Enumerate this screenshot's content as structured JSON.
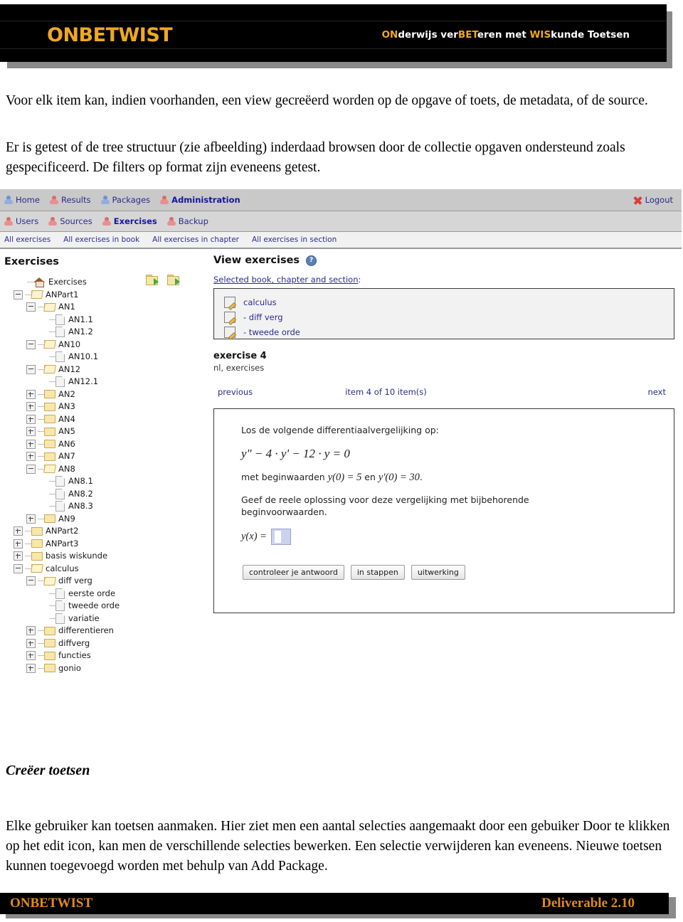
{
  "banner": {
    "logo": "ONBETWIST",
    "tagline_parts": [
      {
        "text": "ON",
        "highlight": true
      },
      {
        "text": "derwijs ver",
        "highlight": false
      },
      {
        "text": "BET",
        "highlight": true
      },
      {
        "text": "eren met ",
        "highlight": false
      },
      {
        "text": "WIS",
        "highlight": true
      },
      {
        "text": "kunde Toetsen",
        "highlight": false
      }
    ],
    "accent_color": "#f0a81e",
    "background_color": "#000000"
  },
  "prose": {
    "intro_1": "Voor elk item kan, indien voorhanden, een view gecreëerd worden op de opgave of toets, de metadata, of de source.",
    "intro_2": "Er is getest of de tree structuur (zie afbeelding) inderdaad browsen door de collectie opgaven ondersteund zoals gespecificeerd. De filters op format zijn eveneens getest.",
    "section_heading": "Creëer toetsen",
    "outro": "Elke gebruiker kan toetsen aanmaken. Hier ziet men een aantal selecties aangemaakt door een gebuiker Door te klikken op het edit icon, kan men de verschillende selecties bewerken. Een selectie verwijderen kan eveneens. Nieuwe toetsen kunnen toegevoegd worden met behulp van Add Package."
  },
  "app": {
    "nav_primary": [
      {
        "label": "Home",
        "icon": "person-icon",
        "icon_color": "blue",
        "active": false
      },
      {
        "label": "Results",
        "icon": "person-icon",
        "icon_color": "red",
        "active": false
      },
      {
        "label": "Packages",
        "icon": "person-icon",
        "icon_color": "blue",
        "active": false
      },
      {
        "label": "Administration",
        "icon": "person-icon",
        "icon_color": "red",
        "active": true
      }
    ],
    "logout": {
      "label": "Logout",
      "icon": "x-icon",
      "color": "#e03a3a"
    },
    "nav_secondary": [
      {
        "label": "Users",
        "icon": "person-icon",
        "icon_color": "red",
        "active": false
      },
      {
        "label": "Sources",
        "icon": "person-icon",
        "icon_color": "red",
        "active": false
      },
      {
        "label": "Exercises",
        "icon": "person-icon",
        "icon_color": "red",
        "active": true
      },
      {
        "label": "Backup",
        "icon": "person-icon",
        "icon_color": "red",
        "active": false
      }
    ],
    "nav_tertiary": [
      "All exercises",
      "All exercises in book",
      "All exercises in chapter",
      "All exercises in section"
    ],
    "left_panel": {
      "title": "Exercises",
      "toolbar_icons": [
        "folder-import-icon",
        "folder-export-icon"
      ],
      "tree": [
        {
          "label": "Exercises",
          "icon": "home-icon",
          "indent": 0,
          "toggle": "none"
        },
        {
          "label": "ANPart1",
          "icon": "folder-open-icon",
          "indent": 1,
          "toggle": "minus"
        },
        {
          "label": "AN1",
          "icon": "folder-open-icon",
          "indent": 2,
          "toggle": "minus"
        },
        {
          "label": "AN1.1",
          "icon": "file-icon",
          "indent": 3,
          "toggle": "none"
        },
        {
          "label": "AN1.2",
          "icon": "file-icon",
          "indent": 3,
          "toggle": "none"
        },
        {
          "label": "AN10",
          "icon": "folder-open-icon",
          "indent": 2,
          "toggle": "minus"
        },
        {
          "label": "AN10.1",
          "icon": "file-icon",
          "indent": 3,
          "toggle": "none"
        },
        {
          "label": "AN12",
          "icon": "folder-open-icon",
          "indent": 2,
          "toggle": "minus"
        },
        {
          "label": "AN12.1",
          "icon": "file-icon",
          "indent": 3,
          "toggle": "none"
        },
        {
          "label": "AN2",
          "icon": "folder-icon",
          "indent": 2,
          "toggle": "plus"
        },
        {
          "label": "AN3",
          "icon": "folder-icon",
          "indent": 2,
          "toggle": "plus"
        },
        {
          "label": "AN4",
          "icon": "folder-icon",
          "indent": 2,
          "toggle": "plus"
        },
        {
          "label": "AN5",
          "icon": "folder-icon",
          "indent": 2,
          "toggle": "plus"
        },
        {
          "label": "AN6",
          "icon": "folder-icon",
          "indent": 2,
          "toggle": "plus"
        },
        {
          "label": "AN7",
          "icon": "folder-icon",
          "indent": 2,
          "toggle": "plus"
        },
        {
          "label": "AN8",
          "icon": "folder-open-icon",
          "indent": 2,
          "toggle": "minus"
        },
        {
          "label": "AN8.1",
          "icon": "file-icon",
          "indent": 3,
          "toggle": "none"
        },
        {
          "label": "AN8.2",
          "icon": "file-icon",
          "indent": 3,
          "toggle": "none"
        },
        {
          "label": "AN8.3",
          "icon": "file-icon",
          "indent": 3,
          "toggle": "none"
        },
        {
          "label": "AN9",
          "icon": "folder-icon",
          "indent": 2,
          "toggle": "plus"
        },
        {
          "label": "ANPart2",
          "icon": "folder-icon",
          "indent": 1,
          "toggle": "plus"
        },
        {
          "label": "ANPart3",
          "icon": "folder-icon",
          "indent": 1,
          "toggle": "plus"
        },
        {
          "label": "basis wiskunde",
          "icon": "folder-icon",
          "indent": 1,
          "toggle": "plus"
        },
        {
          "label": "calculus",
          "icon": "folder-open-icon",
          "indent": 1,
          "toggle": "minus"
        },
        {
          "label": "diff verg",
          "icon": "folder-open-icon",
          "indent": 2,
          "toggle": "minus"
        },
        {
          "label": "eerste orde",
          "icon": "file-icon",
          "indent": 3,
          "toggle": "none"
        },
        {
          "label": "tweede orde",
          "icon": "file-icon",
          "indent": 3,
          "toggle": "none"
        },
        {
          "label": "variatie",
          "icon": "file-icon",
          "indent": 3,
          "toggle": "none"
        },
        {
          "label": "differentieren",
          "icon": "folder-icon",
          "indent": 2,
          "toggle": "plus"
        },
        {
          "label": "diffverg",
          "icon": "folder-icon",
          "indent": 2,
          "toggle": "plus"
        },
        {
          "label": "functies",
          "icon": "folder-icon",
          "indent": 2,
          "toggle": "plus"
        },
        {
          "label": "gonio",
          "icon": "folder-icon",
          "indent": 2,
          "toggle": "plus"
        }
      ]
    },
    "right_panel": {
      "title": "View exercises",
      "help_icon": "help-icon",
      "selection_label": "Selected book, chapter and section",
      "selection_label_suffix": ":",
      "selection_rows": [
        {
          "label": "calculus",
          "icon": "edit-icon"
        },
        {
          "label": "-  diff verg",
          "icon": "edit-icon"
        },
        {
          "label": "-  tweede orde",
          "icon": "edit-icon"
        }
      ],
      "exercise_title": "exercise 4",
      "exercise_subtitle": "nl, exercises",
      "pager": {
        "previous": "previous",
        "status": "item 4 of 10 item(s)",
        "next": "next"
      },
      "exercise_body": {
        "line_1": "Los de volgende differentiaalvergelijking op:",
        "equation": "y\" − 4 · y' − 12 · y = 0",
        "line_2_prefix": "met beginwaarden ",
        "line_2_math_a": "y(0) = 5",
        "line_2_mid": " en ",
        "line_2_math_b": "y'(0) = 30",
        "line_2_suffix": ".",
        "line_3": "Geef de reele oplossing voor deze vergelijking met bijbehorende beginvoorwaarden.",
        "answer_label": "y(x) =",
        "answer_value": ""
      },
      "buttons": [
        "controleer je antwoord",
        "in stappen",
        "uitwerking"
      ]
    }
  },
  "footer": {
    "left": "ONBETWIST",
    "right": "Deliverable 2.10",
    "accent_color": "#e08a1e"
  }
}
